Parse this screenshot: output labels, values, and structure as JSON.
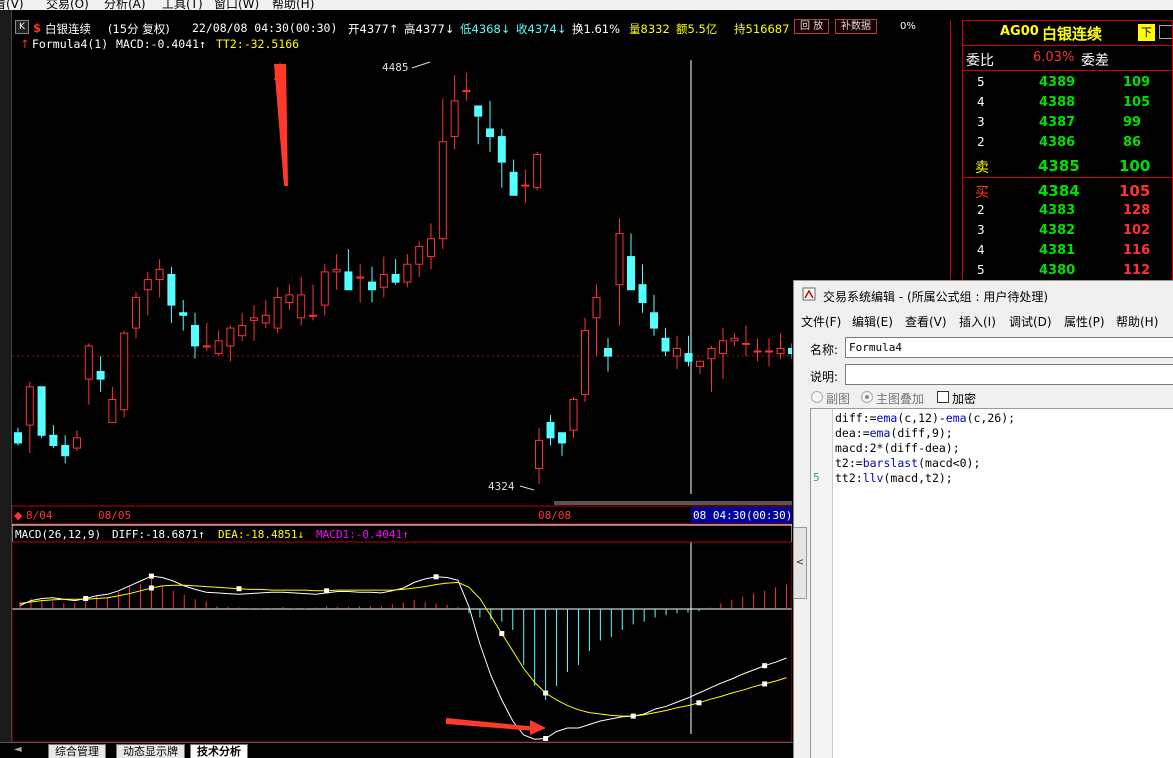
{
  "menubar": {
    "items": [
      "看(V)",
      "交易(O)",
      "分析(A)",
      "工具(T)",
      "窗口(W)",
      "帮助(H)"
    ]
  },
  "infobar": {
    "k_icon": "K",
    "marker": "$",
    "instrument": "白银连续",
    "period": "(15分 复权)",
    "datetime": "22/08/08 04:30(00:30)",
    "open": "开4377↑",
    "high": "高4377↓",
    "low": "低4368↓",
    "close": "收4374↓",
    "turnover": "换1.61%",
    "volume": "量8332",
    "amount": "额5.5亿",
    "hold": "持516687",
    "btn_back": "回 放",
    "btn_fill": "补数据",
    "extra": "0%"
  },
  "formula_bar": {
    "prefix": "↑",
    "name": "Formula4(1)",
    "macd_label": "MACD:-0.4041↑",
    "tt2_label": "TT2:-32.5166"
  },
  "colors": {
    "up": "#ff3232",
    "down": "#54ffff",
    "yellow": "#ffff00",
    "magenta": "#ff00ff",
    "grid": "#c00000",
    "white": "#ffffff",
    "panel_green": "#00e000"
  },
  "chart_data": {
    "type": "candlestick",
    "title": "",
    "price_labels": {
      "high": "4485",
      "low": "4324"
    },
    "candles": [
      [
        4344,
        4346,
        4340,
        4339
      ],
      [
        4347,
        4364,
        4362,
        4336
      ],
      [
        4362,
        4362,
        4343,
        4342
      ],
      [
        4343,
        4347,
        4339,
        4338
      ],
      [
        4339,
        4343,
        4335,
        4332
      ],
      [
        4338,
        4345,
        4342,
        4337
      ],
      [
        4365,
        4379,
        4378,
        4355
      ],
      [
        4368,
        4374,
        4365,
        4360
      ],
      [
        4348,
        4362,
        4357,
        4348
      ],
      [
        4353,
        4384,
        4383,
        4350
      ],
      [
        4385,
        4399,
        4397,
        4381
      ],
      [
        4400,
        4407,
        4404,
        4390
      ],
      [
        4404,
        4412,
        4408,
        4397
      ],
      [
        4406,
        4409,
        4394,
        4387
      ],
      [
        4391,
        4396,
        4390,
        4384
      ],
      [
        4386,
        4391,
        4378,
        4373
      ],
      [
        4378,
        4387,
        4378,
        4376
      ],
      [
        4375,
        4384,
        4380,
        4374
      ],
      [
        4378,
        4386,
        4385,
        4372
      ],
      [
        4382,
        4391,
        4386,
        4380
      ],
      [
        4388,
        4394,
        4389,
        4380
      ],
      [
        4387,
        4396,
        4390,
        4385
      ],
      [
        4385,
        4401,
        4397,
        4383
      ],
      [
        4395,
        4402,
        4398,
        4392
      ],
      [
        4389,
        4405,
        4398,
        4386
      ],
      [
        4390,
        4402,
        4390,
        4388
      ],
      [
        4394,
        4410,
        4407,
        4390
      ],
      [
        4407,
        4414,
        4408,
        4400
      ],
      [
        4407,
        4416,
        4400,
        4400
      ],
      [
        4405,
        4410,
        4405,
        4395
      ],
      [
        4403,
        4409,
        4400,
        4395
      ],
      [
        4401,
        4413,
        4406,
        4397
      ],
      [
        4406,
        4412,
        4403,
        4402
      ],
      [
        4403,
        4414,
        4410,
        4401
      ],
      [
        4410,
        4419,
        4417,
        4405
      ],
      [
        4413,
        4426,
        4420,
        4408
      ],
      [
        4420,
        4475,
        4458,
        4416
      ],
      [
        4460,
        4484,
        4474,
        4455
      ],
      [
        4478,
        4485,
        4478,
        4474
      ],
      [
        4472,
        4470,
        4468,
        4457
      ],
      [
        4463,
        4474,
        4460,
        4454
      ],
      [
        4460,
        4463,
        4450,
        4440
      ],
      [
        4446,
        4451,
        4437,
        4437
      ],
      [
        4441,
        4447,
        4441,
        4434
      ],
      [
        4440,
        4454,
        4453,
        4439
      ]
    ],
    "candles_after_gap": [
      [
        4330,
        4346,
        4341,
        4324
      ],
      [
        4348,
        4351,
        4342,
        4339
      ],
      [
        4344,
        4344,
        4340,
        4335
      ],
      [
        4345,
        4358,
        4357,
        4342
      ],
      [
        4359,
        4389,
        4384,
        4356
      ],
      [
        4389,
        4402,
        4397,
        4374
      ],
      [
        4377,
        4381,
        4374,
        4368
      ],
      [
        4402,
        4428,
        4422,
        4386
      ],
      [
        4413,
        4422,
        4400,
        4400
      ],
      [
        4402,
        4410,
        4395,
        4391
      ],
      [
        4391,
        4398,
        4385,
        4382
      ],
      [
        4381,
        4385,
        4376,
        4374
      ],
      [
        4374,
        4382,
        4377,
        4369
      ],
      [
        4375,
        4382,
        4372,
        4370
      ],
      [
        4370,
        4372,
        4372,
        4367
      ],
      [
        4373,
        4378,
        4377,
        4360
      ],
      [
        4375,
        4385,
        4380,
        4365
      ],
      [
        4380,
        4383,
        4381,
        4378
      ],
      [
        4379,
        4386,
        4379,
        4374
      ],
      [
        4376,
        4381,
        4376,
        4372
      ],
      [
        4376,
        4381,
        4376,
        4370
      ],
      [
        4375,
        4383,
        4377,
        4373
      ],
      [
        4377,
        4379,
        4375,
        4373
      ],
      [
        4376,
        4383,
        4378,
        4374
      ]
    ],
    "time_labels": [
      "8/04",
      "08/05",
      "08/08",
      "08 04:30(00:30)"
    ],
    "macd": {
      "header": "MACD(26,12,9)",
      "diff": "DIFF:-18.6871↑",
      "dea": "DEA:-18.4851↓",
      "macd1": "MACD1:-0.4041↑",
      "bars": [
        1,
        1.5,
        1.3,
        1.1,
        0.8,
        0.9,
        1.6,
        2.0,
        1.6,
        2.4,
        3.2,
        3.6,
        4.3,
        3.3,
        2.6,
        2.0,
        1.4,
        1.1,
        0.4,
        0.3,
        0.2,
        0.1,
        0.1,
        0.1,
        0.3,
        0.1,
        0.1,
        0.2,
        0.4,
        0.3,
        0.3,
        0.4,
        0.4,
        0.4,
        0.7,
        0.9,
        1.3,
        1.0,
        0.8,
        0.6,
        0.3,
        -0.6,
        -1.2,
        -1.5,
        -1.8,
        -3,
        -8,
        -11,
        -13,
        -11,
        -9,
        -8,
        -6,
        -4.5,
        -4,
        -3,
        -2.2,
        -1.8,
        -1.2,
        -0.9,
        -0.6,
        -0.5,
        -0.3,
        0.2,
        0.8,
        1.3,
        1.8,
        2.2,
        2.6,
        3.1,
        3.5
      ],
      "diff_line": [
        0.5,
        1.2,
        1.5,
        1.6,
        1.4,
        1.2,
        1.5,
        1.9,
        2.1,
        2.6,
        3.3,
        4.0,
        4.7,
        4.5,
        4.0,
        3.3,
        2.8,
        2.4,
        2.3,
        2.2,
        2.1,
        2.2,
        2.3,
        2.4,
        2.4,
        2.3,
        2.2,
        2.1,
        2.3,
        2.5,
        2.5,
        2.4,
        2.4,
        2.3,
        2.6,
        3.0,
        3.8,
        4.3,
        4.6,
        4.5,
        4.1,
        0.3,
        -5,
        -9.5,
        -13,
        -16,
        -18,
        -18.6,
        -18.5,
        -17.5,
        -17,
        -17,
        -16.5,
        -16,
        -15.7,
        -15.4,
        -15.3,
        -15.0,
        -14.3,
        -13.9,
        -13.3,
        -12.7,
        -12.0,
        -11.3,
        -10.6,
        -10.0,
        -9.3,
        -8.7,
        -8.1,
        -7.6,
        -7.0
      ],
      "dea_line": [
        0.8,
        1.0,
        1.2,
        1.3,
        1.4,
        1.4,
        1.4,
        1.5,
        1.6,
        1.9,
        2.2,
        2.6,
        3.0,
        3.3,
        3.4,
        3.4,
        3.3,
        3.2,
        3.1,
        3.0,
        2.9,
        2.8,
        2.8,
        2.7,
        2.7,
        2.7,
        2.7,
        2.6,
        2.6,
        2.7,
        2.7,
        2.7,
        2.7,
        2.7,
        2.7,
        2.8,
        3.0,
        3.2,
        3.5,
        3.7,
        3.8,
        3.1,
        1.5,
        -1,
        -3.5,
        -6,
        -8.5,
        -10.5,
        -12,
        -13,
        -13.8,
        -14.4,
        -14.8,
        -15.0,
        -15.2,
        -15.3,
        -15.3,
        -15.1,
        -14.8,
        -14.5,
        -14.1,
        -13.8,
        -13.4,
        -12.9,
        -12.5,
        -12.0,
        -11.6,
        -11.1,
        -10.7,
        -10.3,
        -9.8
      ]
    }
  },
  "quote_panel": {
    "code": "AG00",
    "name": "白银连续",
    "badge": "下",
    "ratio_label": "委比",
    "ratio_value": "6.03%",
    "diff_label": "委差",
    "asks": [
      {
        "lvl": "5",
        "price": "4389",
        "vol": "109"
      },
      {
        "lvl": "4",
        "price": "4388",
        "vol": "105"
      },
      {
        "lvl": "3",
        "price": "4387",
        "vol": "99"
      },
      {
        "lvl": "2",
        "price": "4386",
        "vol": "86"
      }
    ],
    "ask1": {
      "lvl": "卖",
      "price": "4385",
      "vol": "100"
    },
    "bid1": {
      "lvl": "买",
      "price": "4384",
      "vol": "105"
    },
    "bids": [
      {
        "lvl": "2",
        "price": "4383",
        "vol": "128"
      },
      {
        "lvl": "3",
        "price": "4382",
        "vol": "102"
      },
      {
        "lvl": "4",
        "price": "4381",
        "vol": "116"
      },
      {
        "lvl": "5",
        "price": "4380",
        "vol": "112"
      }
    ]
  },
  "editor": {
    "title": "交易系统编辑 - (所属公式组 : 用户待处理)",
    "menu": [
      "文件(F)",
      "编辑(E)",
      "查看(V)",
      "插入(I)",
      "调试(D)",
      "属性(P)",
      "帮助(H)"
    ],
    "name_label": "名称:",
    "name_value": "Formula4",
    "desc_label": "说明:",
    "desc_value": "",
    "radio_sub": "副图",
    "radio_main": "主图叠加",
    "checkbox_encrypt": "加密",
    "line_marker": "5",
    "code_lines": [
      "diff:=ema(c,12)-ema(c,26);",
      "dea:=ema(diff,9);",
      "macd:2*(diff-dea);",
      "t2:=barslast(macd<0);",
      "tt2:llv(macd,t2);"
    ]
  },
  "tabs": [
    "综合管理",
    "动态显示牌",
    "技术分析"
  ]
}
